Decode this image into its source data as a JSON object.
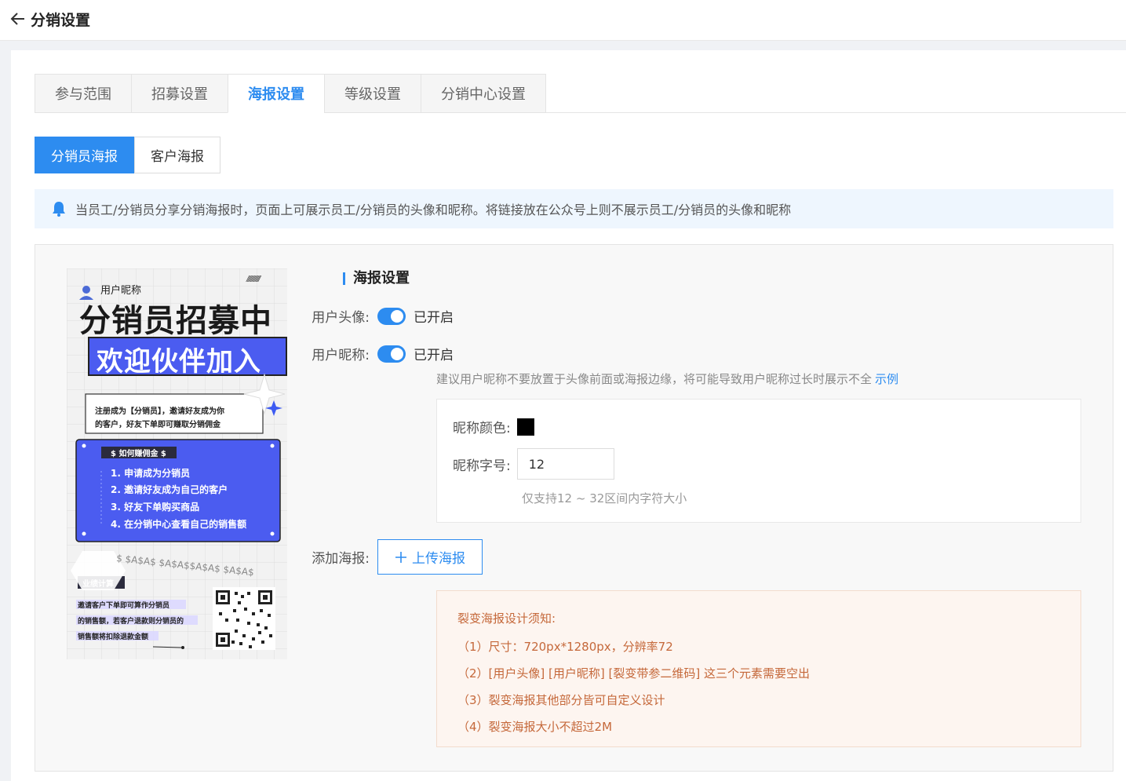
{
  "header": {
    "title": "分销设置"
  },
  "tabs": [
    {
      "label": "参与范围"
    },
    {
      "label": "招募设置"
    },
    {
      "label": "海报设置",
      "active": true
    },
    {
      "label": "等级设置"
    },
    {
      "label": "分销中心设置"
    }
  ],
  "subtabs": [
    {
      "label": "分销员海报",
      "active": true
    },
    {
      "label": "客户海报"
    }
  ],
  "notice": "当员工/分销员分享分销海报时，页面上可展示员工/分销员的头像和昵称。将链接放在公众号上则不展示员工/分销员的头像和昵称",
  "poster": {
    "nickname": "用户昵称",
    "headline": "分销员招募中",
    "banner": "欢迎伙伴加入",
    "intro_line1": "注册成为【分销员】，邀请好友成为你",
    "intro_line2": "的客户，好友下单即可赚取分销佣金",
    "how_title": "$ 如何赚佣金 $",
    "steps": [
      "1. 申请成为分销员",
      "2. 邀请好友成为自己的客户",
      "3. 好友下单购买商品",
      "4. 在分销中心查看自己的销售额"
    ],
    "dollars": "$ $A$A$ $A$A$$A$A$ $A$A$",
    "calc_title": "业绩计算",
    "calc_lines": [
      "邀请客户下单即可算作分销员",
      "的销售额，若客户退款则分销员的",
      "销售额将扣除退款金额"
    ],
    "slashes": "////////////"
  },
  "settings": {
    "section_title": "海报设置",
    "avatar": {
      "label": "用户头像:",
      "state": "已开启"
    },
    "nickname": {
      "label": "用户昵称:",
      "state": "已开启"
    },
    "tip": "建议用户昵称不要放置于头像前面或海报边缘，将可能导致用户昵称过长时展示不全",
    "tip_link": "示例",
    "color_label": "昵称颜色:",
    "color_value": "#000000",
    "size_label": "昵称字号:",
    "size_value": "12",
    "size_hint": "仅支持12 ~ 32区间内字符大小",
    "add_label": "添加海报:",
    "upload_label": "上传海报"
  },
  "rules": {
    "title": "裂变海报设计须知:",
    "items": [
      "（1）尺寸：720px*1280px，分辨率72",
      "（2）[用户头像] [用户昵称] [裂变带参二维码] 这三个元素需要空出",
      "（3）裂变海报其他部分皆可自定义设计",
      "（4）裂变海报大小不超过2M"
    ]
  },
  "colors": {
    "accent": "#2d8cf0",
    "poster_blue": "#4b5cf0"
  }
}
